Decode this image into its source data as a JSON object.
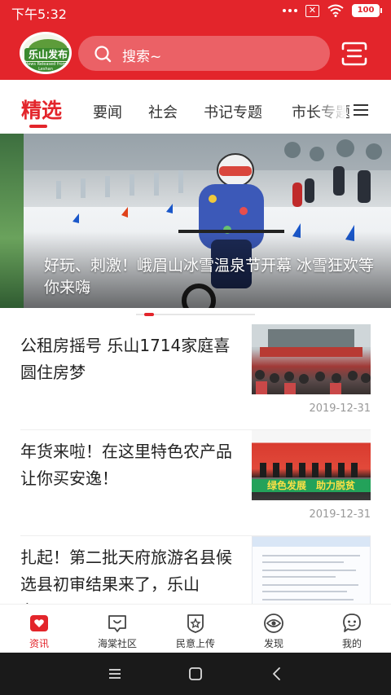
{
  "status_bar": {
    "time": "下午5:32",
    "battery": "100"
  },
  "header": {
    "logo_text": "乐山发布",
    "logo_sub": "News Released from Leshan",
    "search_placeholder": "搜索~",
    "brand_color": "#e3252b"
  },
  "tabs": [
    {
      "label": "精选",
      "active": true
    },
    {
      "label": "要闻"
    },
    {
      "label": "社会"
    },
    {
      "label": "书记专题"
    },
    {
      "label": "市长专题"
    }
  ],
  "banner": {
    "caption": "好玩、刺激！峨眉山冰雪温泉节开幕 冰雪狂欢等你来嗨"
  },
  "news": [
    {
      "title": "公租房摇号 乐山1714家庭喜圆住房梦",
      "date": "2019-12-31"
    },
    {
      "title": "年货来啦！在这里特色农产品让你买安逸！",
      "date": "2019-12-31",
      "thumb_band": "绿色发展　助力脱贫"
    },
    {
      "title": "扎起！第二批天府旅游名县候选县初审结果来了，乐山有……",
      "date": ""
    }
  ],
  "bottom_nav": [
    {
      "label": "资讯",
      "icon": "news-icon",
      "active": true
    },
    {
      "label": "海棠社区",
      "icon": "community-icon"
    },
    {
      "label": "民意上传",
      "icon": "upload-opinion-icon"
    },
    {
      "label": "发现",
      "icon": "discover-eye-icon"
    },
    {
      "label": "我的",
      "icon": "profile-icon"
    }
  ]
}
